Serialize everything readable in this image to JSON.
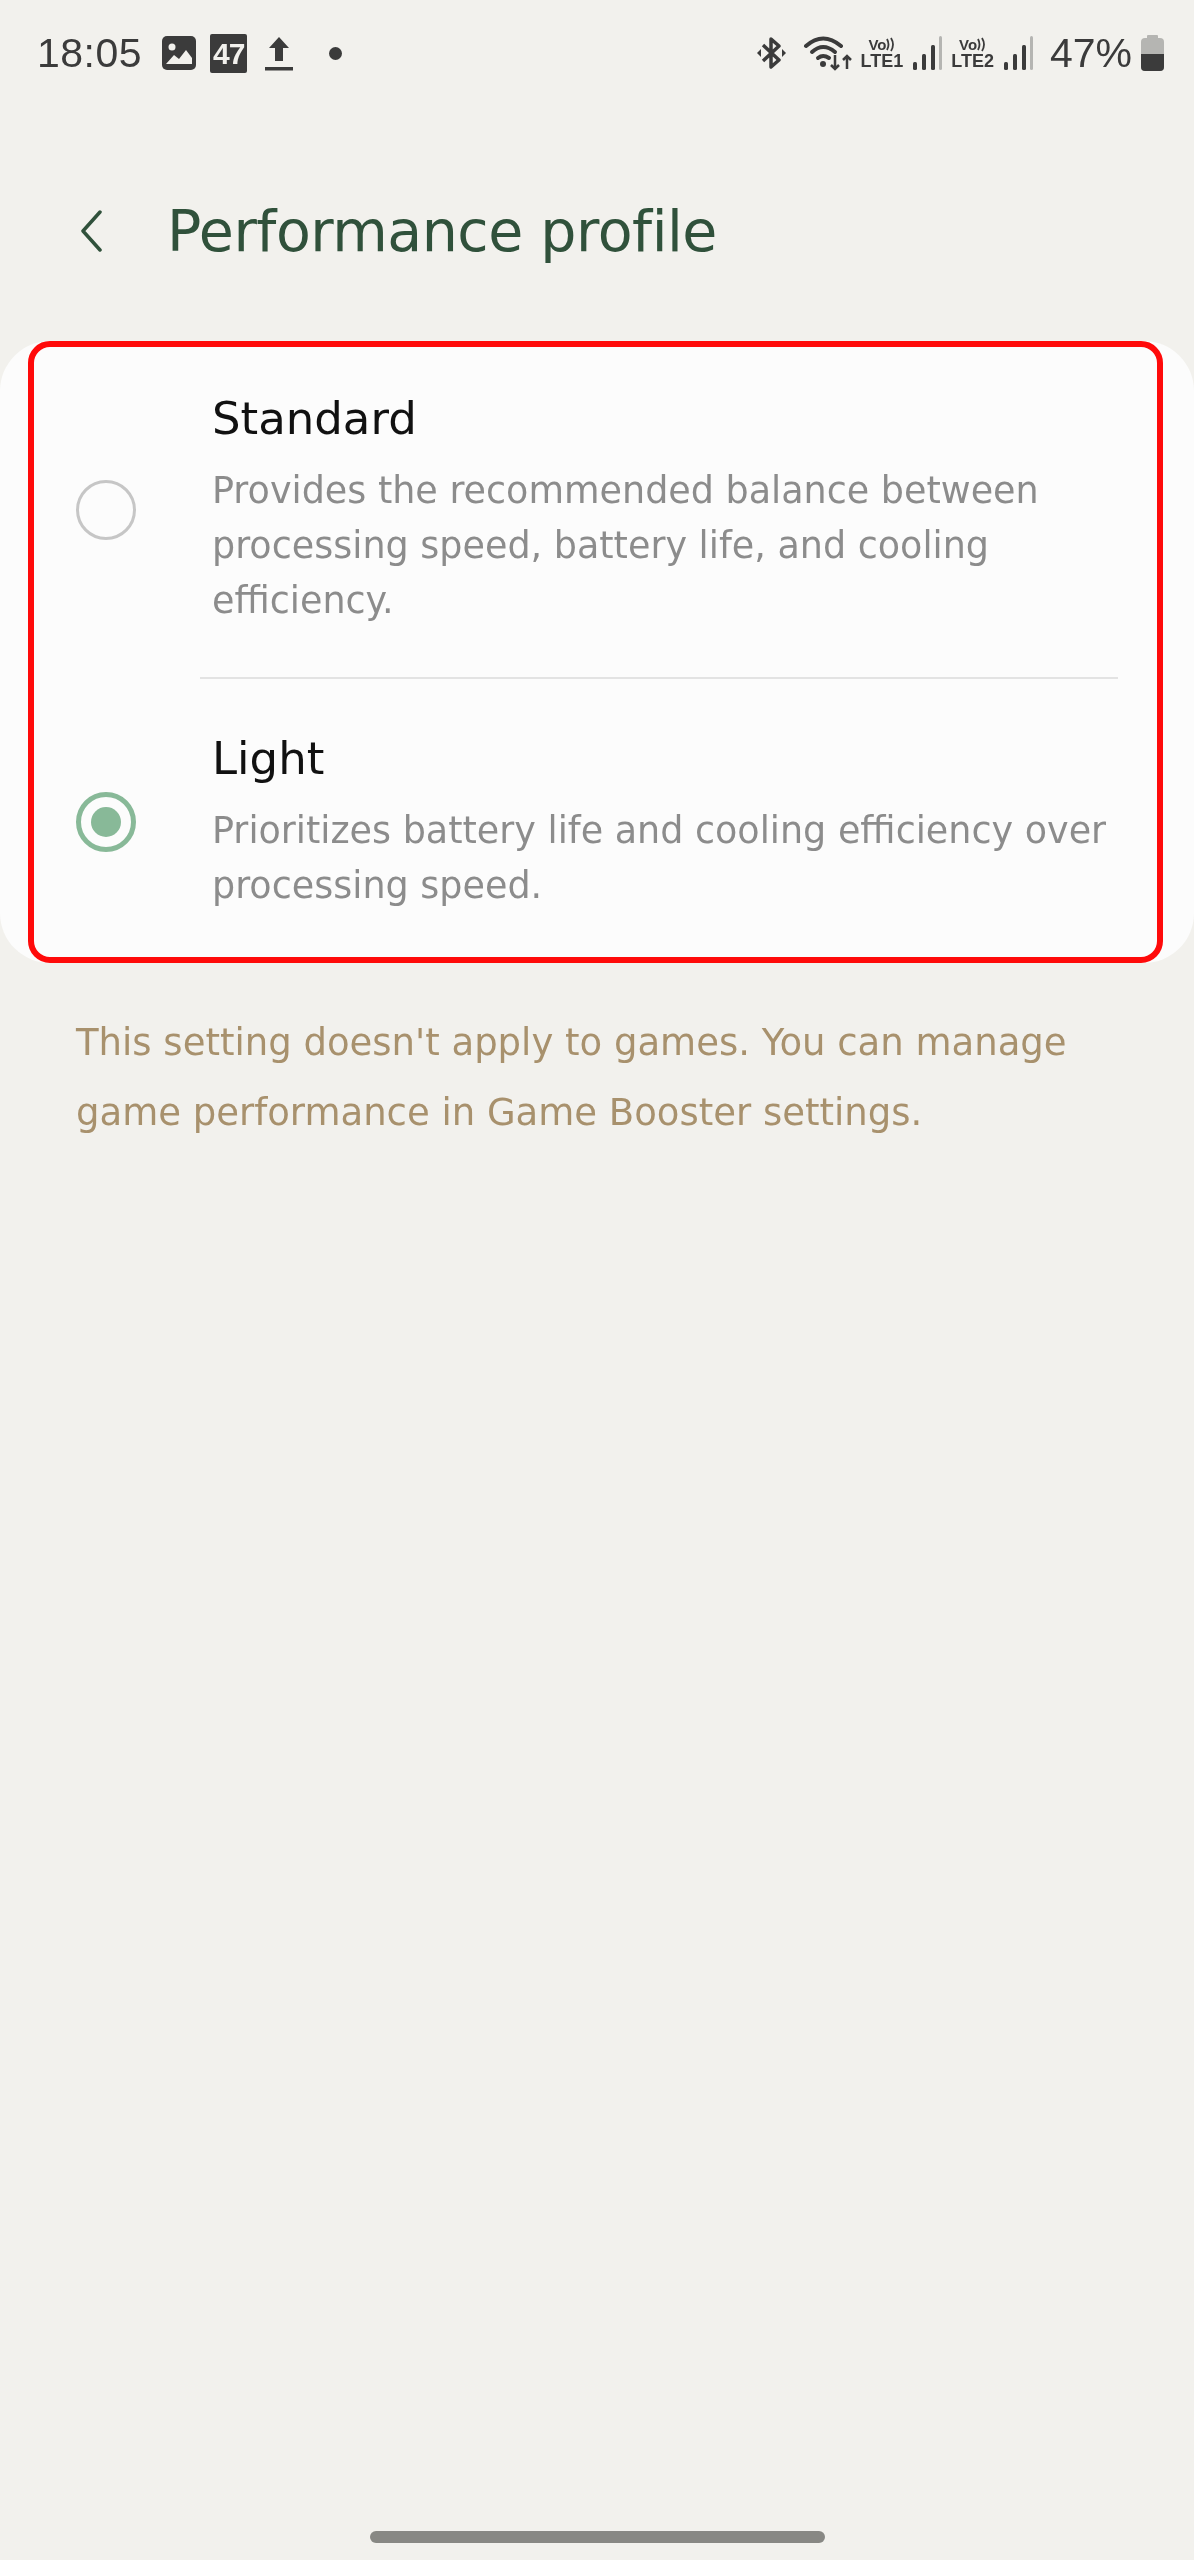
{
  "status_bar": {
    "time": "18:05",
    "notifications": [
      {
        "kind": "gallery"
      },
      {
        "kind": "count",
        "text": "47"
      },
      {
        "kind": "upload"
      },
      {
        "kind": "dot"
      }
    ],
    "system": [
      {
        "kind": "bluetooth"
      },
      {
        "kind": "wifi"
      },
      {
        "kind": "sim",
        "volte": "Vo",
        "network": "LTE1"
      },
      {
        "kind": "sim",
        "volte": "Vo",
        "network": "LTE2"
      }
    ],
    "battery": "47%"
  },
  "header": {
    "title": "Performance profile"
  },
  "options_card": {
    "highlighted": true,
    "options": [
      {
        "title": "Standard",
        "description": "Provides the recommended balance between processing speed, battery life, and cooling efficiency.",
        "selected": false
      },
      {
        "title": "Light",
        "description": "Prioritizes battery life and cooling efficiency over processing speed.",
        "selected": true
      }
    ]
  },
  "note": "This setting doesn't apply to games. You can manage game performance in Game Booster settings."
}
